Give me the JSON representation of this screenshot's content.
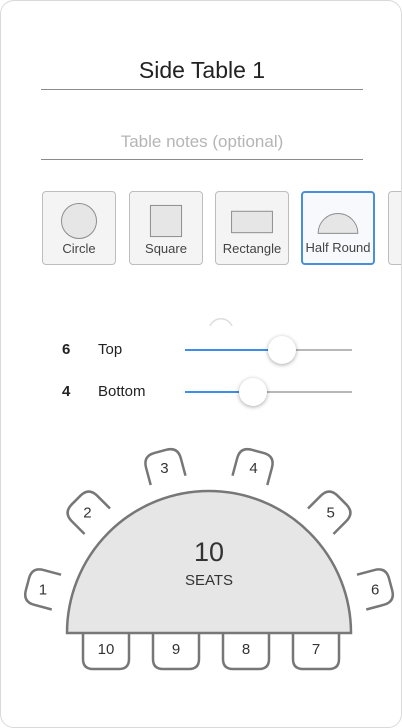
{
  "table": {
    "name": "Side Table 1",
    "notes_value": "",
    "notes_placeholder": "Table notes (optional)"
  },
  "shapes": [
    {
      "label": "Circle",
      "icon": "circle-icon",
      "selected": false
    },
    {
      "label": "Square",
      "icon": "square-icon",
      "selected": false
    },
    {
      "label": "Rectangle",
      "icon": "rectangle-icon",
      "selected": false
    },
    {
      "label": "Half Round",
      "icon": "half-round-icon",
      "selected": true
    }
  ],
  "sliders": {
    "top": {
      "count": "6",
      "label": "Top",
      "fraction": 0.58
    },
    "bottom": {
      "count": "4",
      "label": "Bottom",
      "fraction": 0.41
    }
  },
  "diagram": {
    "total": "10",
    "total_label": "SEATS",
    "top_seats": [
      "1",
      "2",
      "3",
      "4",
      "5",
      "6"
    ],
    "bottom_seats": [
      "10",
      "9",
      "8",
      "7"
    ]
  },
  "colors": {
    "accent": "#4a90d9",
    "slider_fill": "#3d8ee8",
    "shape_fill": "#e6e6e6",
    "outline": "#777777"
  }
}
